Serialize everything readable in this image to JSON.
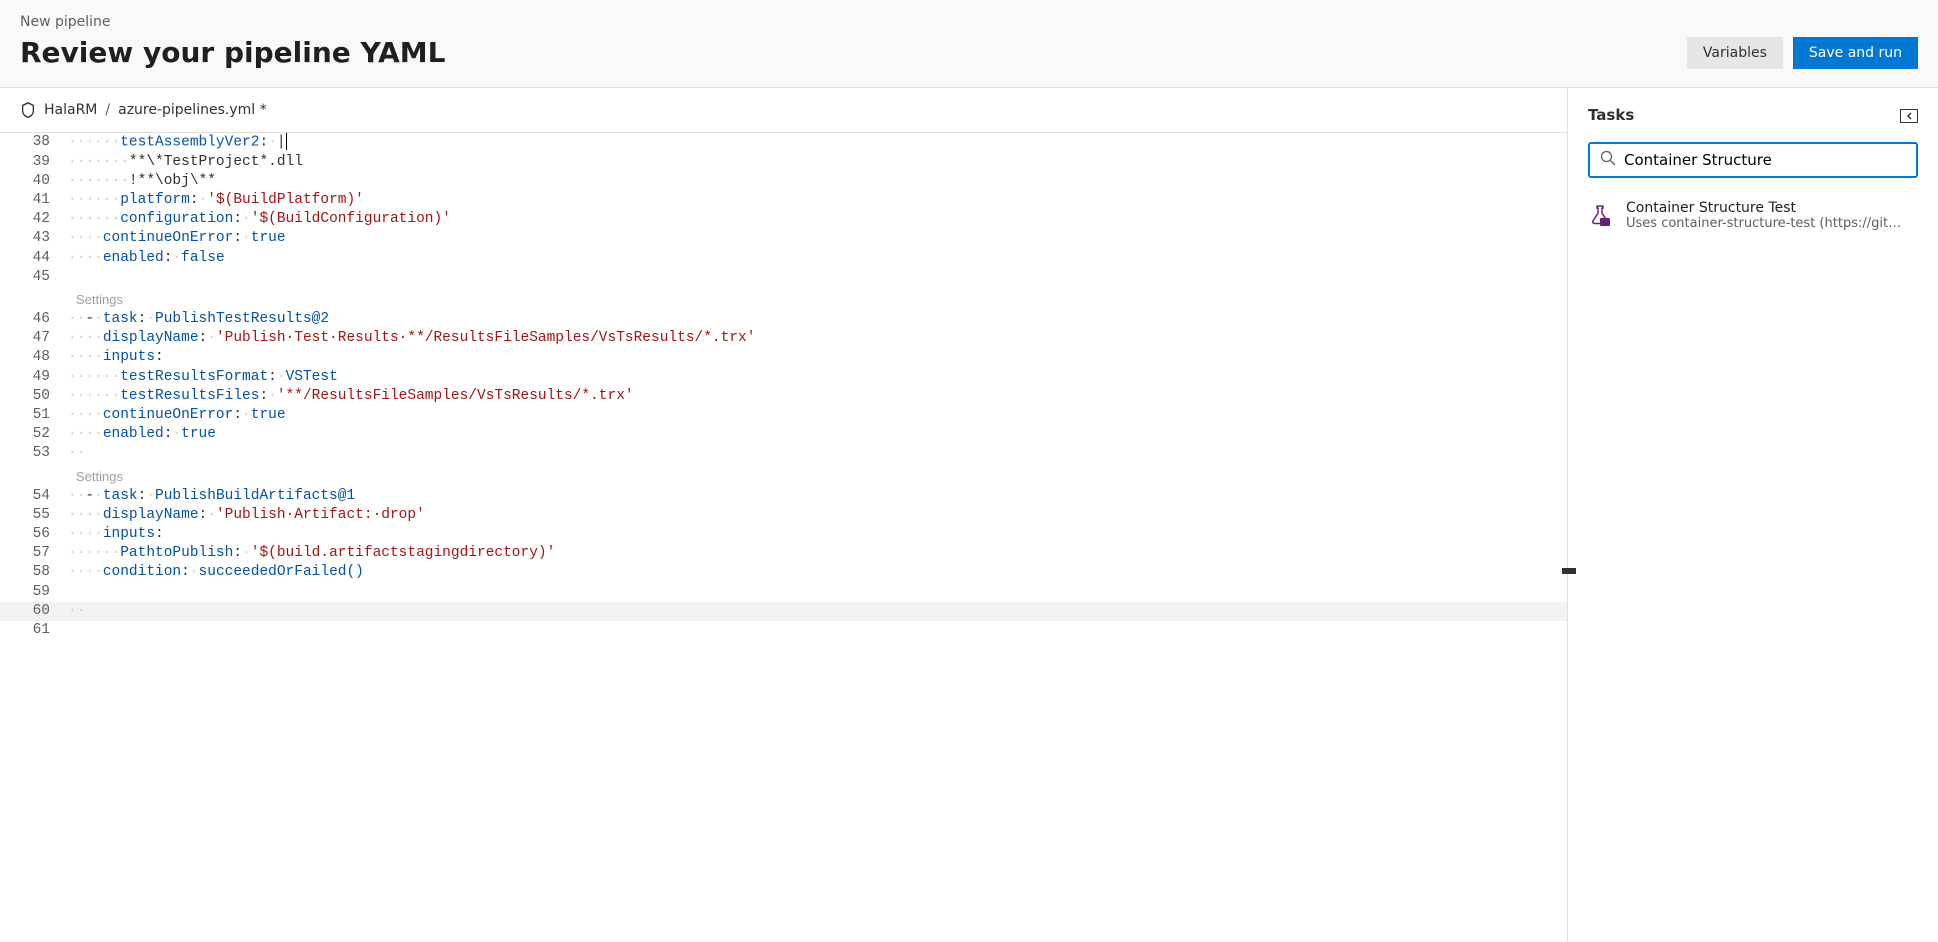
{
  "header": {
    "breadcrumb": "New pipeline",
    "title": "Review your pipeline YAML",
    "variables_label": "Variables",
    "save_run_label": "Save and run"
  },
  "file_crumb": {
    "repo": "HalaRM",
    "sep": "/",
    "file": "azure-pipelines.yml *"
  },
  "editor": {
    "lines": [
      {
        "n": 38,
        "html": "<span class='ws'>······</span><span class='key'>testAssemblyVer2</span>:<span class='ws'>·</span>|<span class='cursor'></span>"
      },
      {
        "n": 39,
        "html": "<span class='ws'>·······</span>**\\*TestProject*.dll"
      },
      {
        "n": 40,
        "html": "<span class='ws'>·······</span>!**\\obj\\**"
      },
      {
        "n": 41,
        "html": "<span class='ws'>······</span><span class='key'>platform</span>:<span class='ws'>·</span><span class='str'>'$(BuildPlatform)'</span>"
      },
      {
        "n": 42,
        "html": "<span class='ws'>······</span><span class='key'>configuration</span>:<span class='ws'>·</span><span class='str'>'$(BuildConfiguration)'</span>"
      },
      {
        "n": 43,
        "html": "<span class='ws'>····</span><span class='key'>continueOnError</span>:<span class='ws'>·</span><span class='bool'>true</span>"
      },
      {
        "n": 44,
        "html": "<span class='ws'>····</span><span class='key'>enabled</span>:<span class='ws'>·</span><span class='bool'>false</span>"
      },
      {
        "n": 45,
        "html": ""
      },
      {
        "hint": "Settings"
      },
      {
        "n": 46,
        "html": "<span class='ws'>··</span>-<span class='ws'>·</span><span class='key'>task</span>:<span class='ws'>·</span><span class='bool'>PublishTestResults@2</span>"
      },
      {
        "n": 47,
        "html": "<span class='ws'>····</span><span class='key'>displayName</span>:<span class='ws'>·</span><span class='str'>'Publish·Test·Results·**/ResultsFileSamples/VsTsResults/*.trx'</span>"
      },
      {
        "n": 48,
        "html": "<span class='ws'>····</span><span class='key'>inputs</span>:"
      },
      {
        "n": 49,
        "html": "<span class='ws'>······</span><span class='key'>testResultsFormat</span>:<span class='ws'>·</span><span class='bool'>VSTest</span>"
      },
      {
        "n": 50,
        "html": "<span class='ws'>······</span><span class='key'>testResultsFiles</span>:<span class='ws'>·</span><span class='str'>'**/ResultsFileSamples/VsTsResults/*.trx'</span>"
      },
      {
        "n": 51,
        "html": "<span class='ws'>····</span><span class='key'>continueOnError</span>:<span class='ws'>·</span><span class='bool'>true</span>"
      },
      {
        "n": 52,
        "html": "<span class='ws'>····</span><span class='key'>enabled</span>:<span class='ws'>·</span><span class='bool'>true</span>"
      },
      {
        "n": 53,
        "html": "<span class='ws'>··</span>"
      },
      {
        "hint": "Settings"
      },
      {
        "n": 54,
        "html": "<span class='ws'>··</span>-<span class='ws'>·</span><span class='key'>task</span>:<span class='ws'>·</span><span class='bool'>PublishBuildArtifacts@1</span>"
      },
      {
        "n": 55,
        "html": "<span class='ws'>····</span><span class='key'>displayName</span>:<span class='ws'>·</span><span class='str'>'Publish·Artifact:·drop'</span>"
      },
      {
        "n": 56,
        "html": "<span class='ws'>····</span><span class='key'>inputs</span>:"
      },
      {
        "n": 57,
        "html": "<span class='ws'>······</span><span class='key'>PathtoPublish</span>:<span class='ws'>·</span><span class='str'>'$(build.artifactstagingdirectory)'</span>"
      },
      {
        "n": 58,
        "html": "<span class='ws'>····</span><span class='key'>condition</span>:<span class='ws'>·</span><span class='bool'>succeededOrFailed()</span>"
      },
      {
        "n": 59,
        "html": ""
      },
      {
        "n": 60,
        "html": "<span class='ws'>··</span>",
        "current": true
      },
      {
        "n": 61,
        "html": ""
      }
    ]
  },
  "tasks": {
    "title": "Tasks",
    "search_value": "Container Structure",
    "results": [
      {
        "title": "Container Structure Test",
        "desc": "Uses container-structure-test (https://github.com…"
      }
    ]
  }
}
